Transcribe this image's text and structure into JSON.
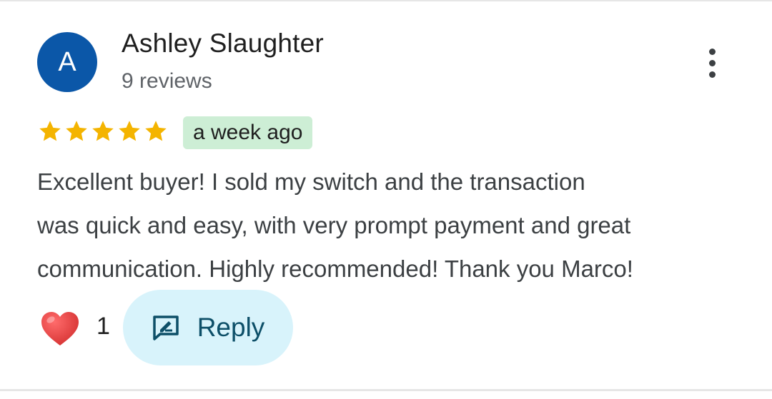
{
  "review": {
    "avatar_letter": "A",
    "author_name": "Ashley Slaughter",
    "review_count": "9 reviews",
    "rating": 5,
    "rating_max": 5,
    "time_ago": "a week ago",
    "body_lines": [
      "Excellent buyer! I sold my switch and the transaction",
      "was quick and easy, with very prompt payment and great",
      "communication. Highly recommended! Thank you Marco!"
    ]
  },
  "reactions": {
    "icon": "heart-icon",
    "count": "1"
  },
  "actions": {
    "reply_label": "Reply",
    "reply_icon": "reply-icon",
    "menu_icon": "more-vert-icon"
  },
  "colors": {
    "avatar_bg": "#0b57a8",
    "star": "#f4b400",
    "time_chip_bg": "#cdeed5",
    "reply_bg": "#d8f3fb",
    "reply_text": "#0d4f68",
    "heart": "#e53935"
  }
}
